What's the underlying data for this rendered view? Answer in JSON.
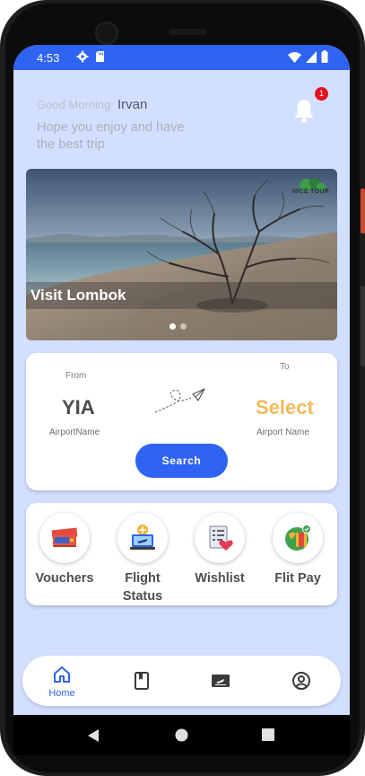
{
  "status_bar": {
    "time": "4:53",
    "color": "#2f63f2",
    "left_icons": [
      "gear-icon",
      "sd-card-icon"
    ],
    "right_icons": [
      "wifi-icon",
      "signal-icon",
      "battery-icon"
    ]
  },
  "header": {
    "greeting": "Good Morning",
    "user_name": "Irvan",
    "subtitle": "Hope you enjoy and have the best trip",
    "notification_count": "1"
  },
  "banner": {
    "title": "Visit Lombok",
    "brand": "NICE TOUR",
    "slide_count": 2,
    "active_slide": 1
  },
  "flight_search": {
    "from_label": "From",
    "to_label": "To",
    "from_code": "YIA",
    "to_code": "Select",
    "from_name": "AirportName",
    "to_name": "Airport Name",
    "search_label": "Search",
    "accent": "#f3bc5a"
  },
  "menu": [
    {
      "label": "Vouchers",
      "icon": "voucher-icon"
    },
    {
      "label": "Flight Status",
      "icon": "flight-status-icon"
    },
    {
      "label": "Wishlist",
      "icon": "wishlist-icon"
    },
    {
      "label": "Flit Pay",
      "icon": "wallet-icon"
    }
  ],
  "bottom_nav": {
    "home_label": "Home",
    "items": [
      "home-icon",
      "book-icon",
      "ticket-icon",
      "profile-icon"
    ],
    "active": "home"
  }
}
